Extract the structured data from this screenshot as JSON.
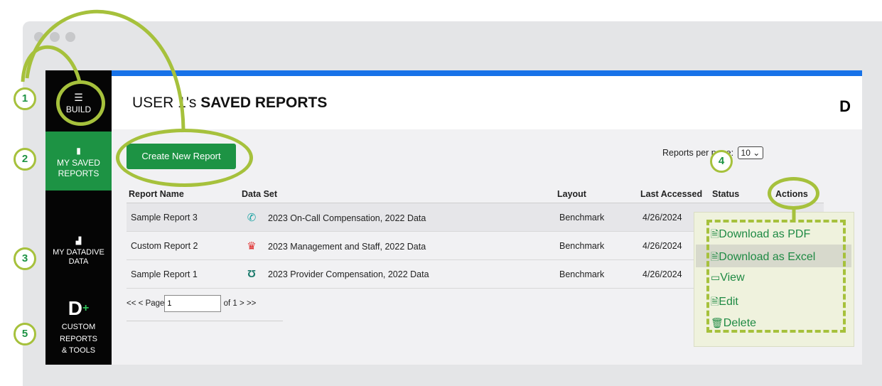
{
  "sidebar": {
    "items": [
      {
        "label": "BUILD",
        "icon": "stack-icon"
      },
      {
        "label": "MY SAVED REPORTS",
        "icon": "bookmark-icon"
      },
      {
        "label": "MY DATADIVE DATA",
        "icon": "chart-icon"
      },
      {
        "label": "CUSTOM REPORTS & TOOLS",
        "icon": "datadive-logo-plus-icon"
      }
    ]
  },
  "header": {
    "title_prefix": "USER 1's ",
    "title_bold": "SAVED REPORTS",
    "logo": "D"
  },
  "toolbar": {
    "create_label": "Create New Report",
    "per_page_label": "Reports per page:",
    "per_page_value": "10"
  },
  "table": {
    "columns": [
      "Report Name",
      "Data Set",
      "Layout",
      "Last Accessed",
      "Status",
      "Actions"
    ],
    "rows": [
      {
        "name": "Sample Report 3",
        "icon": "phone-icon",
        "dataset": "2023 On-Call Compensation, 2022 Data",
        "layout": "Benchmark",
        "accessed": "4/26/2024"
      },
      {
        "name": "Custom Report 2",
        "icon": "management-icon",
        "dataset": "2023 Management and Staff, 2022 Data",
        "layout": "Benchmark",
        "accessed": "4/26/2024"
      },
      {
        "name": "Sample Report 1",
        "icon": "stethoscope-icon",
        "dataset": "2023 Provider Compensation, 2022 Data",
        "layout": "Benchmark",
        "accessed": "4/26/2024"
      }
    ]
  },
  "pager": {
    "first": "<<",
    "prev": "<",
    "page_label": "Page",
    "page_value": "1",
    "of_label": "of 1",
    "next": ">",
    "last": ">>"
  },
  "actions_menu": [
    "Download as PDF",
    "Download as Excel",
    "View",
    "Edit",
    "Delete"
  ],
  "callouts": [
    "1",
    "2",
    "3",
    "4",
    "5"
  ],
  "colors": {
    "accent_green": "#1d9344",
    "highlight": "#a6c13c",
    "top_bar": "#1772e8"
  }
}
